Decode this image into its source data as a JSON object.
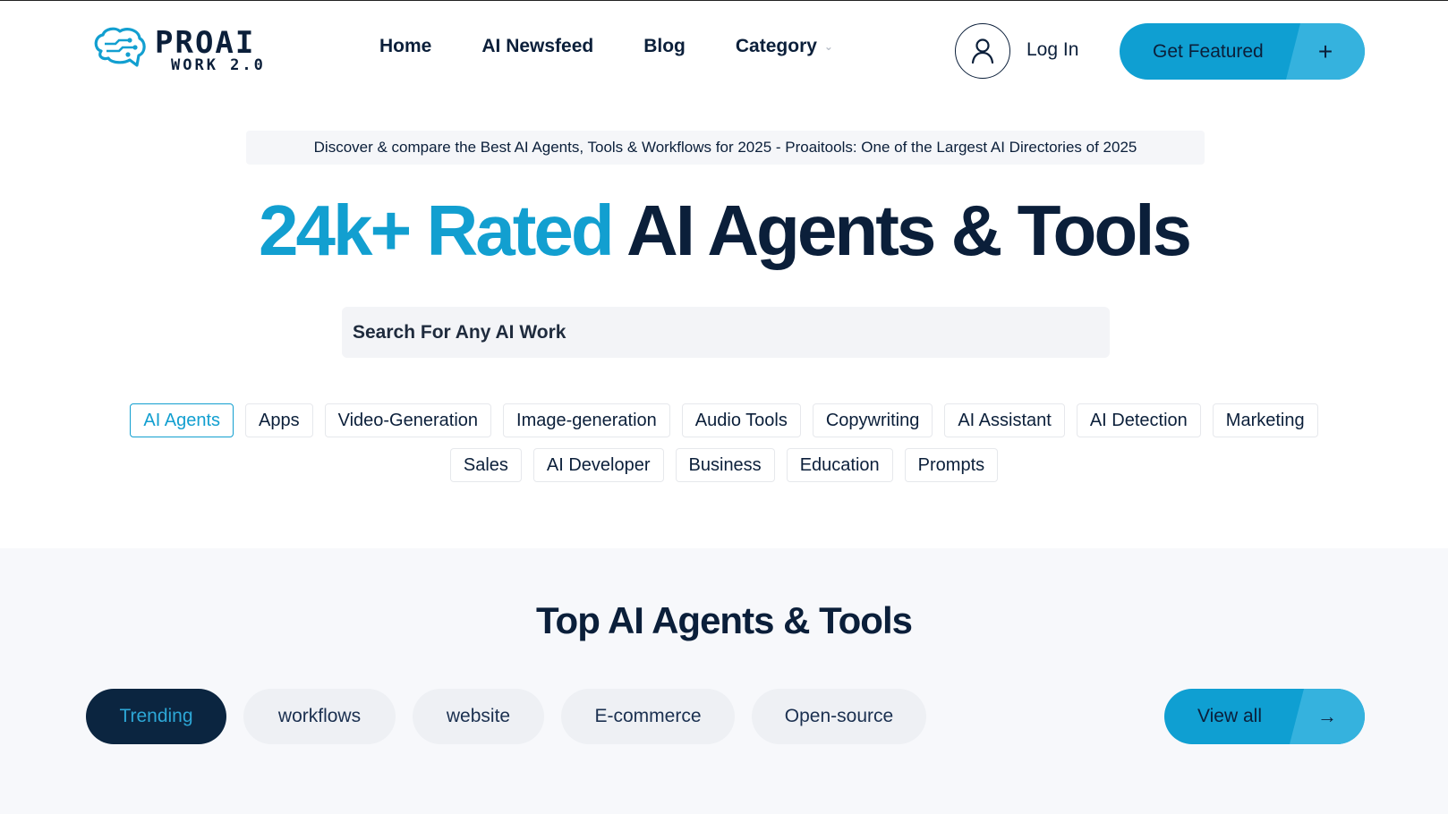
{
  "logo": {
    "main": "PROAI",
    "sub": "WORK 2.0",
    "icon": "brain-circuit-icon"
  },
  "nav": {
    "items": [
      {
        "label": "Home"
      },
      {
        "label": "AI Newsfeed"
      },
      {
        "label": "Blog"
      },
      {
        "label": "Category"
      }
    ]
  },
  "header": {
    "login_label": "Log In",
    "featured_label": "Get Featured",
    "featured_plus": "+"
  },
  "announcement": "Discover & compare the Best AI Agents, Tools & Workflows for 2025 - Proaitools: One of the Largest AI Directories of 2025",
  "hero": {
    "accent": "24k+ Rated",
    "dark": "AI Agents & Tools"
  },
  "search": {
    "placeholder": "Search For Any AI Work",
    "value": ""
  },
  "chips": {
    "row1": [
      "AI Agents",
      "Apps",
      "Video-Generation",
      "Image-generation",
      "Audio Tools",
      "Copywriting",
      "AI Assistant",
      "AI Detection",
      "Marketing"
    ],
    "row2": [
      "Sales",
      "AI Developer",
      "Business",
      "Education",
      "Prompts"
    ],
    "active": "AI Agents"
  },
  "section": {
    "title": "Top AI Agents & Tools",
    "tabs": [
      "Trending",
      "workflows",
      "website",
      "E-commerce",
      "Open-source"
    ],
    "active_tab": "Trending",
    "view_all_label": "View all",
    "view_all_arrow": "→"
  },
  "colors": {
    "accent": "#129fd0",
    "dark": "#0b1f3a",
    "button": "#0f9fd2"
  }
}
